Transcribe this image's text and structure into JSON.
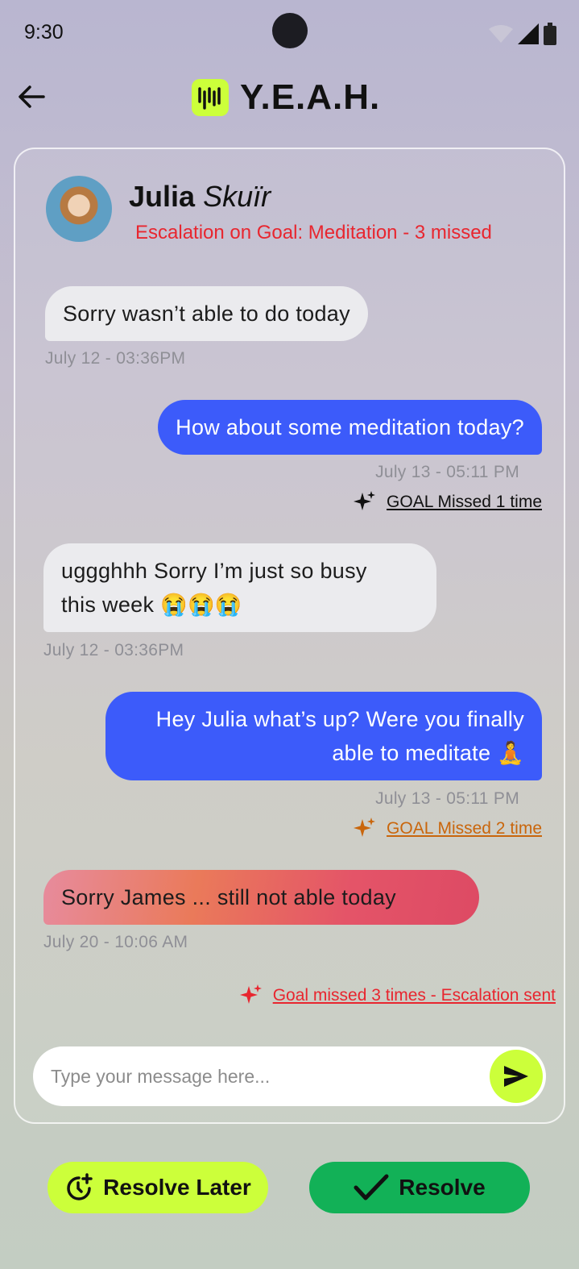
{
  "status_bar": {
    "time": "9:30"
  },
  "header": {
    "logo_text": "Y.E.A.H."
  },
  "contact": {
    "first_name": "Julia",
    "last_name": "Skuïr",
    "escalation": "Escalation on Goal: Meditation - 3 missed"
  },
  "messages": [
    {
      "direction": "in",
      "text": "Sorry wasn’t able to do today",
      "time": "July 12 - 03:36PM"
    },
    {
      "direction": "out",
      "text": "How about some meditation today?",
      "time": "July 13 - 05:11 PM",
      "goal_note": "GOAL Missed 1 time"
    },
    {
      "direction": "in",
      "text_line1": "uggghhh Sorry I’m just so busy",
      "text_line2": "this week 😭😭😭",
      "time": "July 12 - 03:36PM"
    },
    {
      "direction": "out",
      "text_line1": "Hey Julia what’s up? Were you finally",
      "text_line2": "able to meditate 🧘",
      "time": "July 13 - 05:11 PM",
      "goal_note": "GOAL Missed 2 time"
    },
    {
      "direction": "in",
      "text": "Sorry James ... still not able today",
      "time": "July 20 - 10:06 AM"
    }
  ],
  "escalation_note": "Goal missed 3 times - Escalation sent",
  "composer": {
    "placeholder": "Type your message here..."
  },
  "actions": {
    "resolve_later": "Resolve Later",
    "resolve": "Resolve"
  },
  "colors": {
    "accent_lime": "#ccff3a",
    "outgoing_bubble": "#3c5bfa",
    "resolve_green": "#12b157",
    "escalation_red": "#e8262f",
    "warning_orange": "#c9660c"
  },
  "icons": [
    "back-arrow-icon",
    "logo-icon",
    "sparkle-icon",
    "send-icon",
    "clock-plus-icon",
    "check-icon",
    "wifi-icon",
    "signal-icon",
    "battery-icon"
  ]
}
